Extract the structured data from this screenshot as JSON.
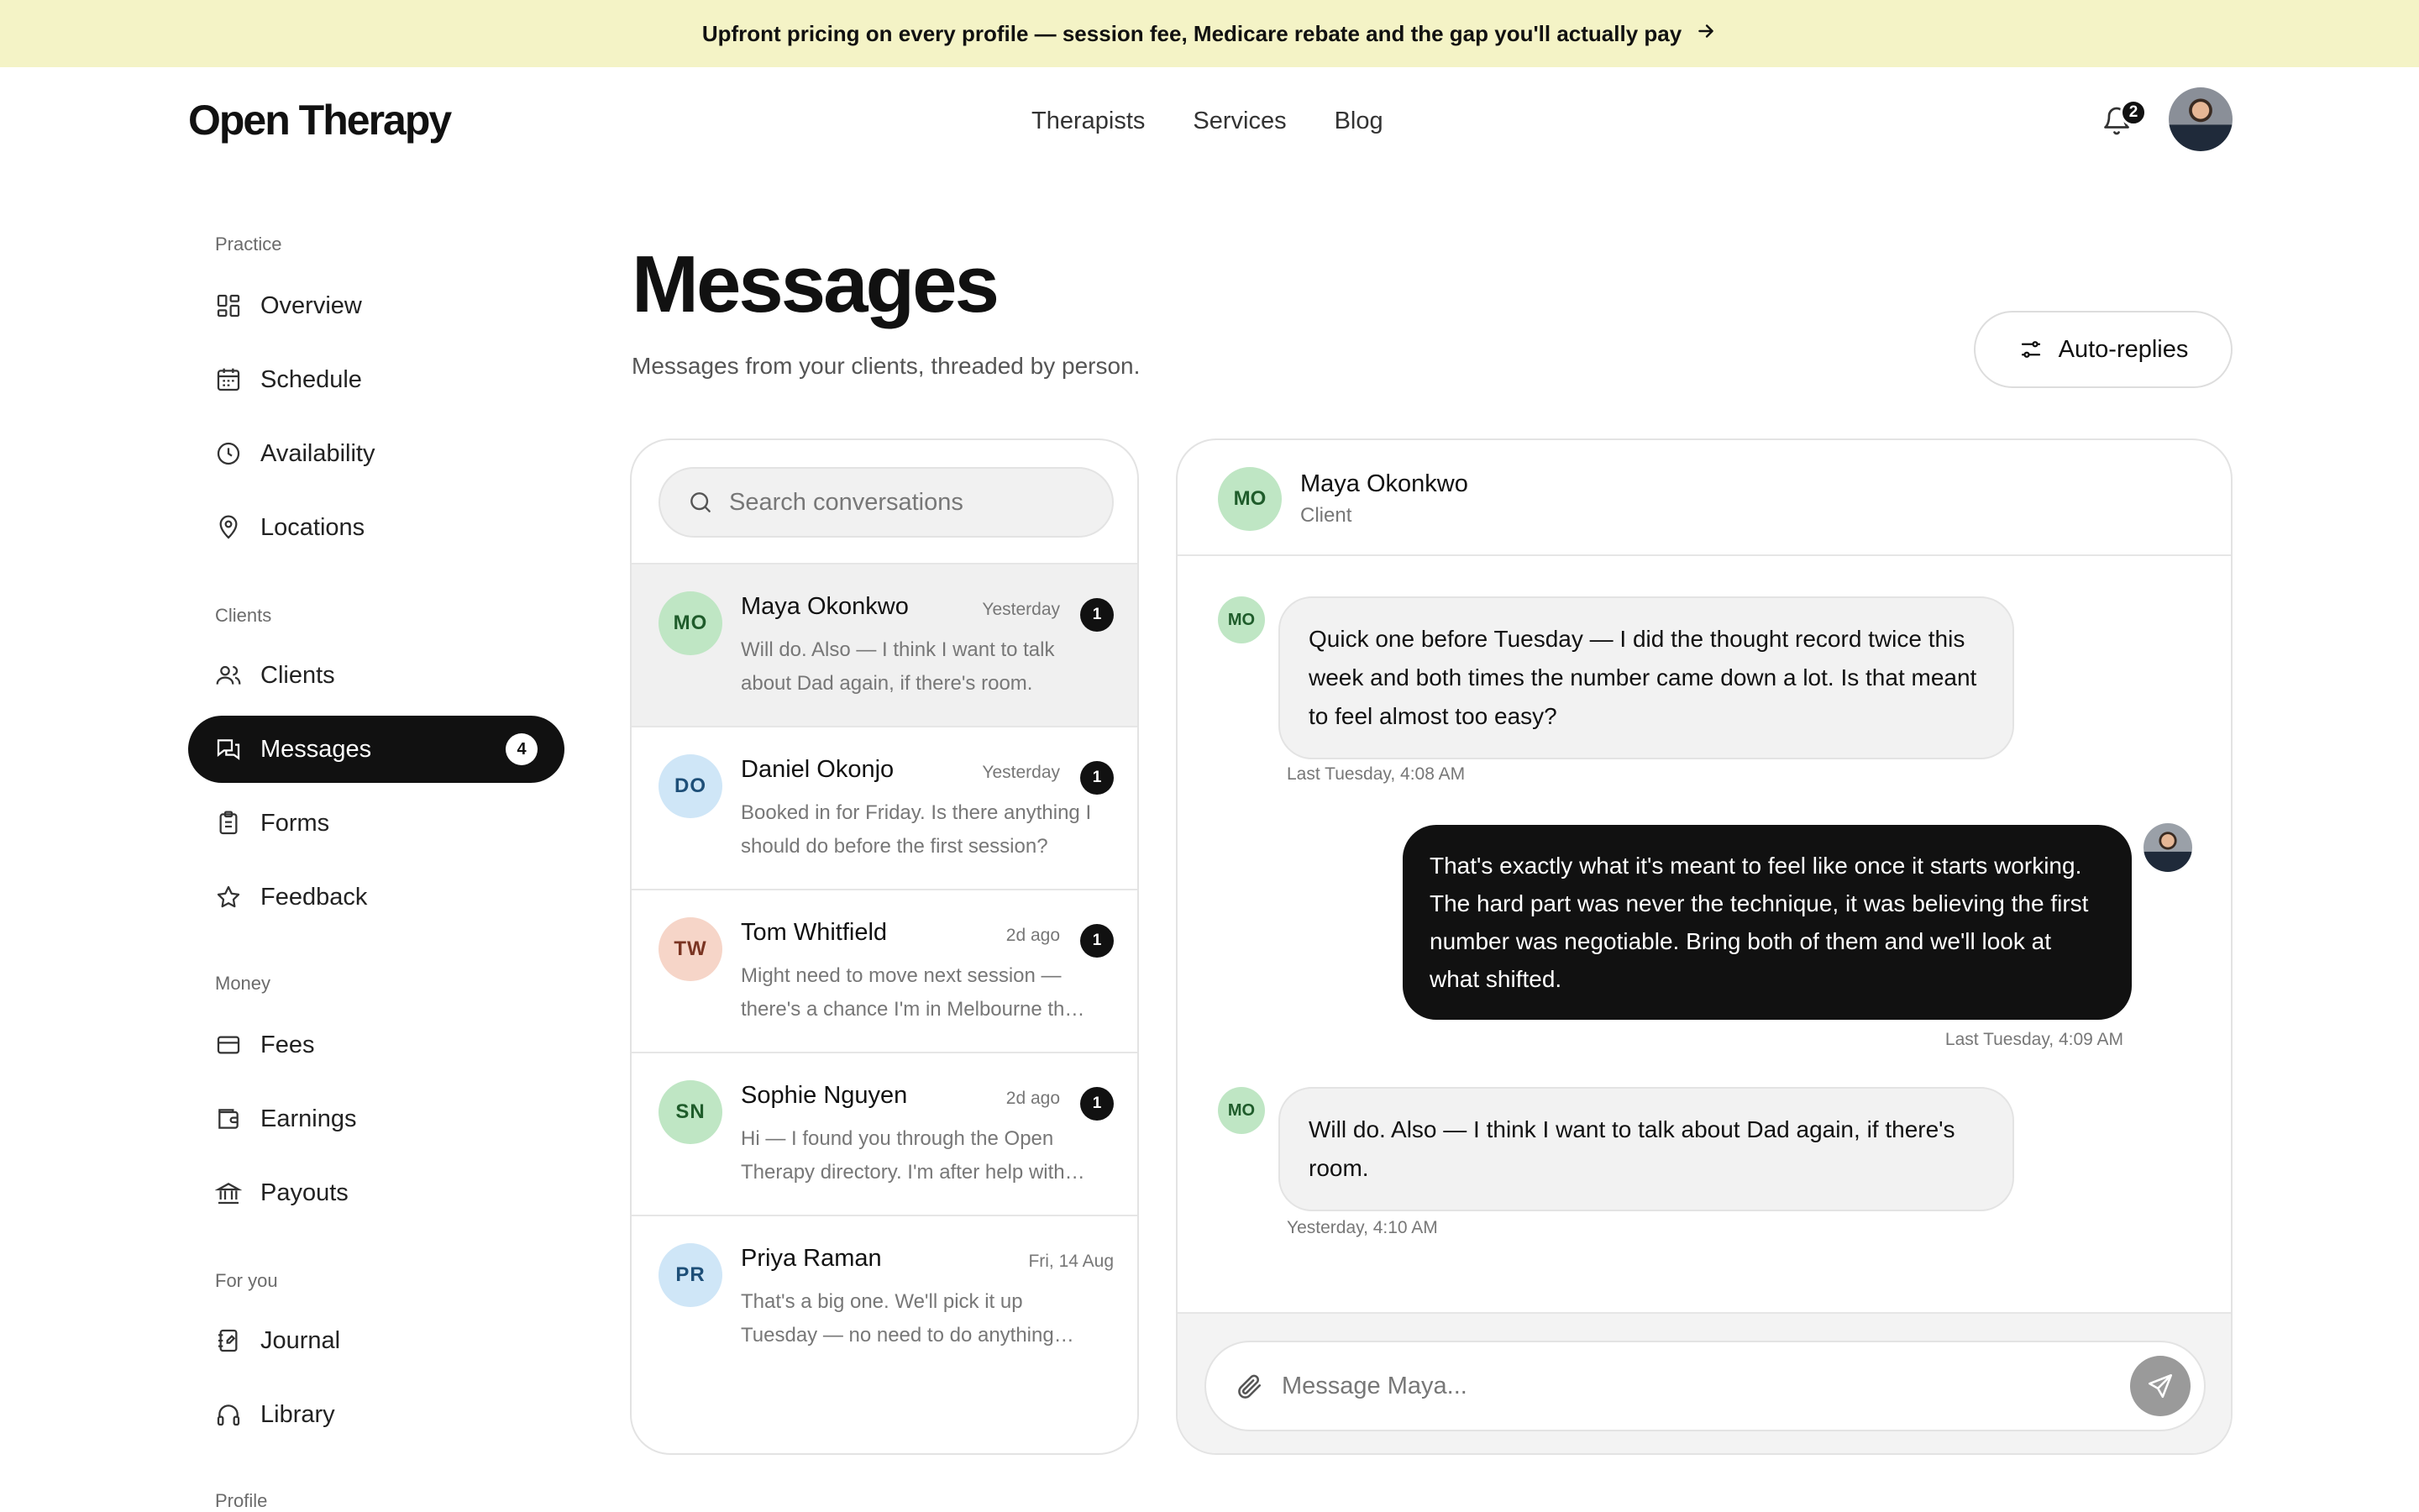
{
  "banner": {
    "text": "Upfront pricing on every profile — session fee, Medicare rebate and the gap you'll actually pay",
    "icon": "arrow-right-icon"
  },
  "header": {
    "logo": "Open Therapy",
    "nav": [
      "Therapists",
      "Services",
      "Blog"
    ],
    "notification_count": "2"
  },
  "sidebar": {
    "sections": [
      {
        "title": "Practice",
        "items": [
          {
            "label": "Overview",
            "icon": "grid-icon"
          },
          {
            "label": "Schedule",
            "icon": "calendar-icon"
          },
          {
            "label": "Availability",
            "icon": "clock-icon"
          },
          {
            "label": "Locations",
            "icon": "pin-icon"
          }
        ]
      },
      {
        "title": "Clients",
        "items": [
          {
            "label": "Clients",
            "icon": "users-icon"
          },
          {
            "label": "Messages",
            "icon": "chat-icon",
            "badge": "4",
            "active": true
          },
          {
            "label": "Forms",
            "icon": "clipboard-icon"
          },
          {
            "label": "Feedback",
            "icon": "star-icon"
          }
        ]
      },
      {
        "title": "Money",
        "items": [
          {
            "label": "Fees",
            "icon": "card-icon"
          },
          {
            "label": "Earnings",
            "icon": "wallet-icon"
          },
          {
            "label": "Payouts",
            "icon": "bank-icon"
          }
        ]
      },
      {
        "title": "For you",
        "items": [
          {
            "label": "Journal",
            "icon": "journal-icon"
          },
          {
            "label": "Library",
            "icon": "headphones-icon"
          }
        ]
      },
      {
        "title": "Profile",
        "items": []
      }
    ]
  },
  "main": {
    "title": "Messages",
    "subtitle": "Messages from your clients, threaded by person.",
    "auto_replies_label": "Auto-replies"
  },
  "conversations": {
    "search_placeholder": "Search conversations",
    "items": [
      {
        "initials": "MO",
        "name": "Maya Okonkwo",
        "time": "Yesterday",
        "badge": "1",
        "preview": "Will do. Also — I think I want to talk about Dad again, if there's room.",
        "avatar_bg": "#bfe6c4",
        "avatar_fg": "#1f5c2b",
        "selected": true
      },
      {
        "initials": "DO",
        "name": "Daniel Okonjo",
        "time": "Yesterday",
        "badge": "1",
        "preview": "Booked in for Friday. Is there anything I should do before the first session?",
        "avatar_bg": "#cfe6f7",
        "avatar_fg": "#1e4f78"
      },
      {
        "initials": "TW",
        "name": "Tom Whitfield",
        "time": "2d ago",
        "badge": "1",
        "preview": "Might need to move next session — there's a chance I'm in Melbourne that week.",
        "avatar_bg": "#f6d5c8",
        "avatar_fg": "#7a3422"
      },
      {
        "initials": "SN",
        "name": "Sophie Nguyen",
        "time": "2d ago",
        "badge": "1",
        "preview": "Hi — I found you through the Open Therapy directory. I'm after help with anxiety.",
        "avatar_bg": "#bfe6c4",
        "avatar_fg": "#1f5c2b"
      },
      {
        "initials": "PR",
        "name": "Priya Raman",
        "time": "Fri, 14 Aug",
        "badge": "",
        "preview": "That's a big one. We'll pick it up Tuesday — no need to do anything else with it.",
        "avatar_bg": "#cfe6f7",
        "avatar_fg": "#1e4f78"
      }
    ]
  },
  "chat": {
    "contact": {
      "initials": "MO",
      "name": "Maya Okonkwo",
      "role": "Client"
    },
    "messages": [
      {
        "from": "client",
        "initials": "MO",
        "text": "Quick one before Tuesday — I did the thought record twice this week and both times the number came down a lot. Is that meant to feel almost too easy?",
        "time": "Last Tuesday, 4:08 AM"
      },
      {
        "from": "me",
        "text": "That's exactly what it's meant to feel like once it starts working. The hard part was never the technique, it was believing the first number was negotiable. Bring both of them and we'll look at what shifted.",
        "time": "Last Tuesday, 4:09 AM"
      },
      {
        "from": "client",
        "initials": "MO",
        "text": "Will do. Also — I think I want to talk about Dad again, if there's room.",
        "time": "Yesterday, 4:10 AM"
      }
    ],
    "composer_placeholder": "Message Maya..."
  }
}
